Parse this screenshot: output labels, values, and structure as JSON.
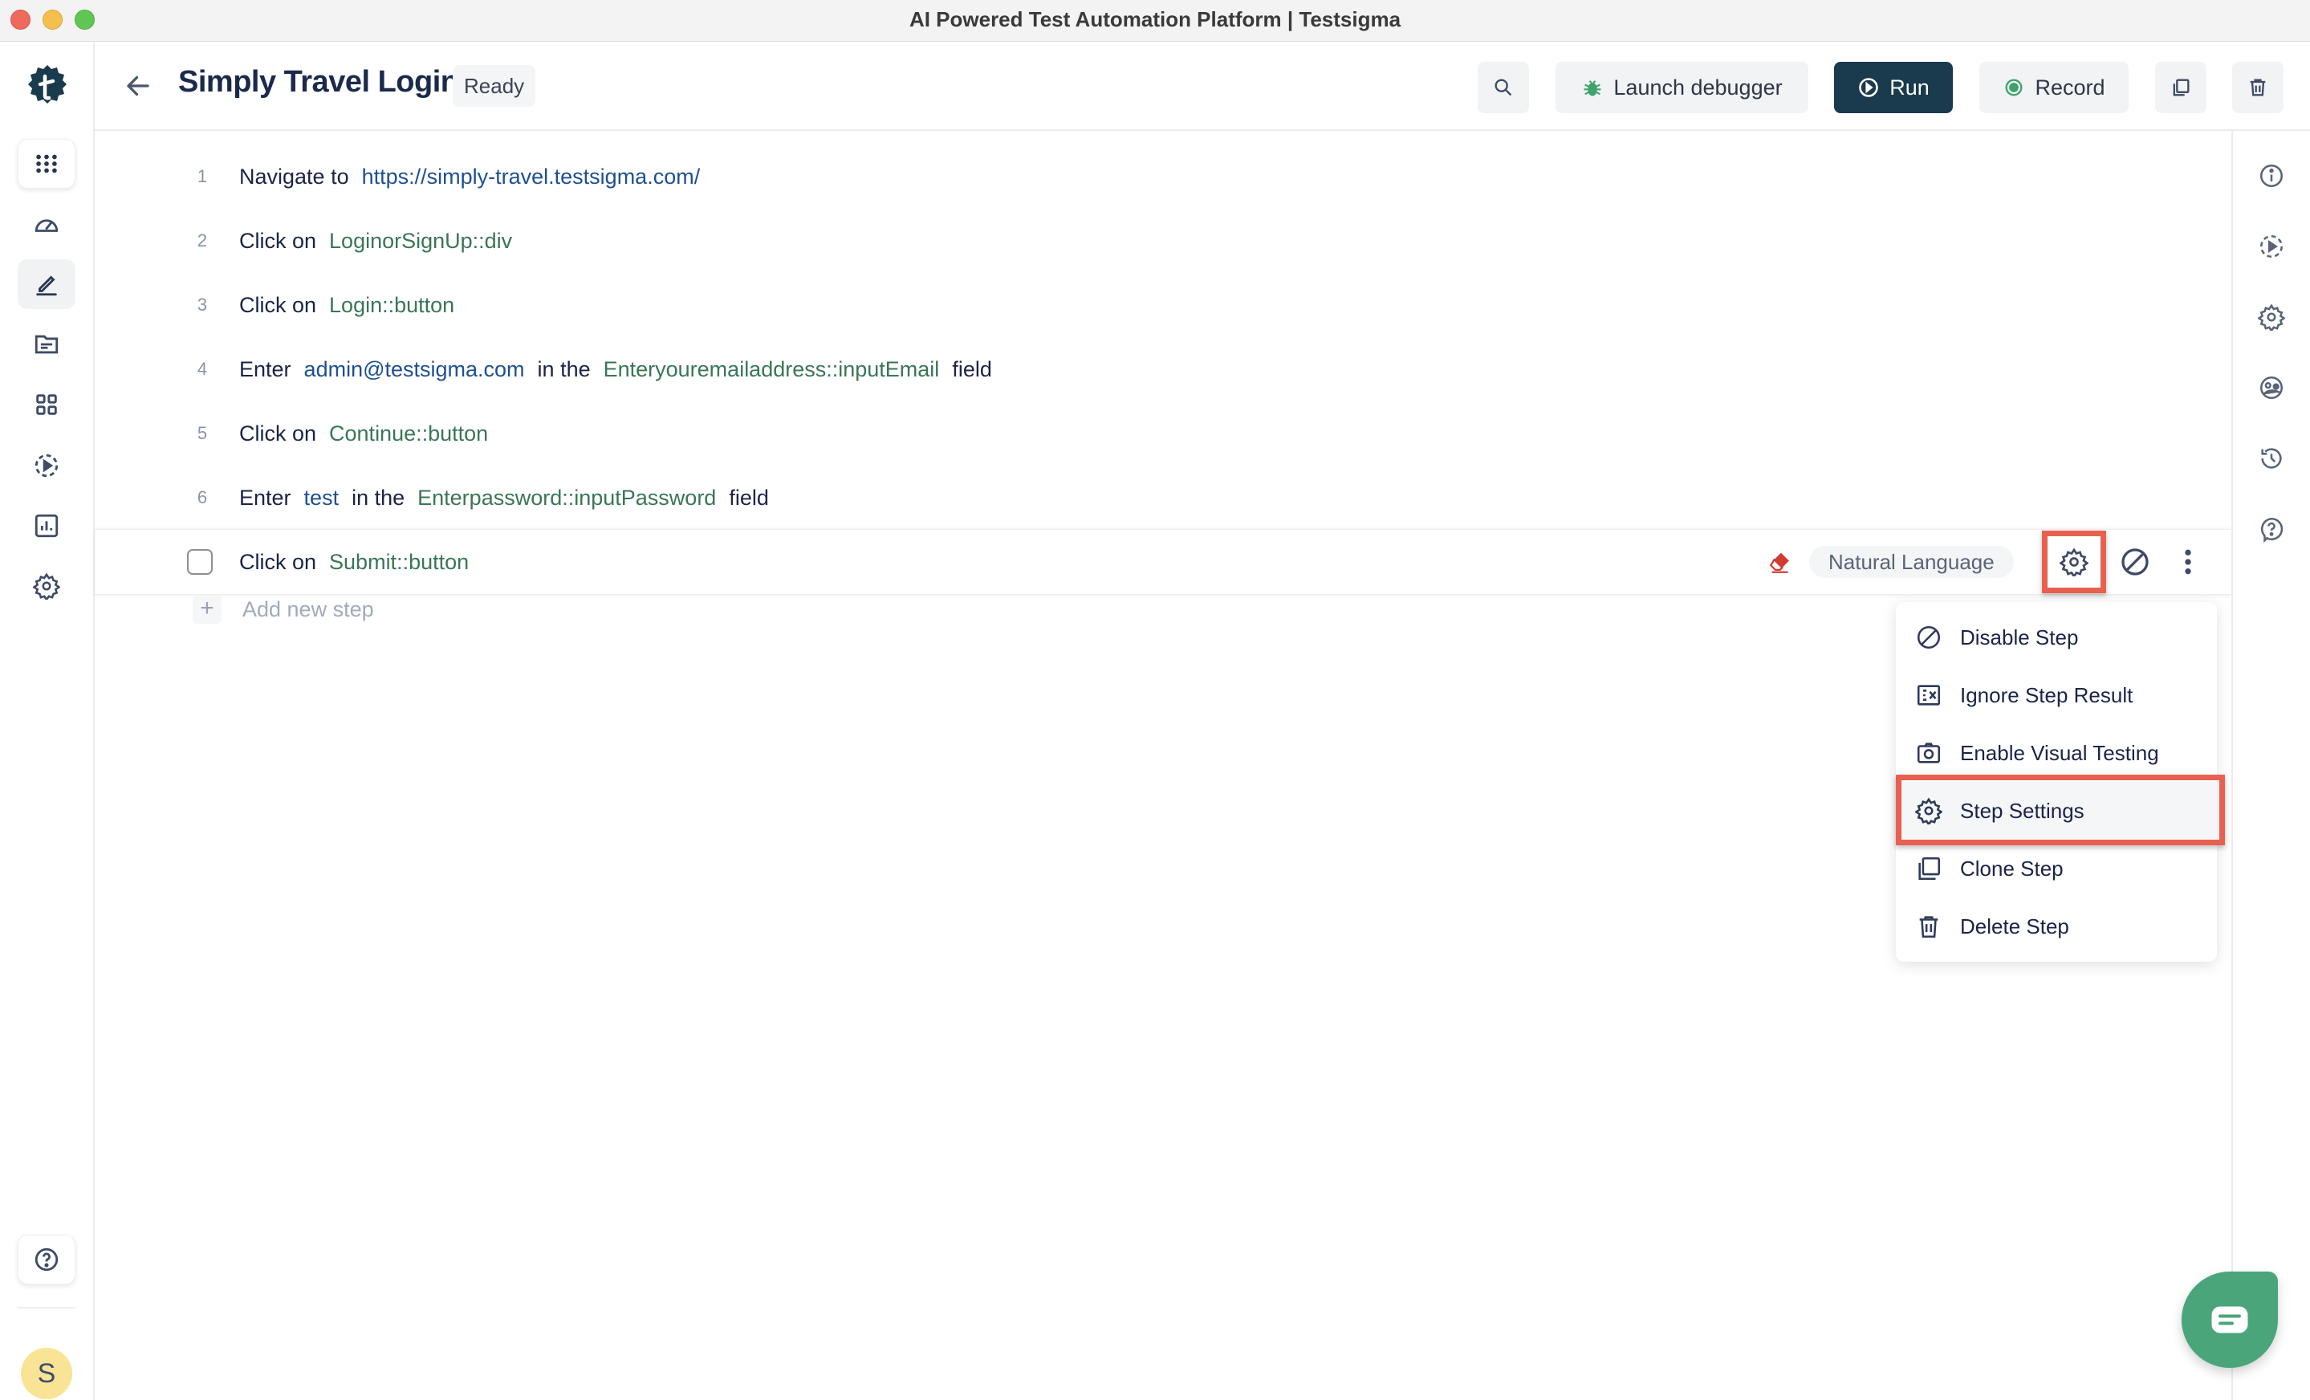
{
  "window": {
    "title": "AI Powered Test Automation Platform | Testsigma"
  },
  "sidebar": {
    "logo": "testsigma-logo",
    "items": [
      {
        "name": "apps-grid",
        "icon": "grid-dots-icon"
      },
      {
        "name": "dashboard",
        "icon": "speedometer-icon"
      },
      {
        "name": "test-cases",
        "icon": "pencil-icon",
        "active": true
      },
      {
        "name": "test-data",
        "icon": "folder-icon"
      },
      {
        "name": "elements",
        "icon": "four-squares-icon"
      },
      {
        "name": "runs",
        "icon": "dashed-play-icon"
      },
      {
        "name": "reports",
        "icon": "bar-chart-icon"
      },
      {
        "name": "settings",
        "icon": "gear-icon"
      }
    ],
    "help_icon": "help-circle-icon",
    "avatar_initial": "S"
  },
  "header": {
    "title": "Simply Travel Login",
    "status": "Ready",
    "buttons": {
      "search": "search-icon",
      "launch_debugger": "Launch debugger",
      "run": "Run",
      "record": "Record",
      "copy": "copy-icon",
      "delete": "trash-icon"
    }
  },
  "steps": [
    {
      "number": "1",
      "tokens": [
        {
          "type": "plain",
          "text": "Navigate to"
        },
        {
          "type": "data",
          "text": "https://simply-travel.testsigma.com/"
        }
      ]
    },
    {
      "number": "2",
      "tokens": [
        {
          "type": "plain",
          "text": "Click on"
        },
        {
          "type": "elem",
          "text": "LoginorSignUp::div"
        }
      ]
    },
    {
      "number": "3",
      "tokens": [
        {
          "type": "plain",
          "text": "Click on"
        },
        {
          "type": "elem",
          "text": "Login::button"
        }
      ]
    },
    {
      "number": "4",
      "tokens": [
        {
          "type": "plain",
          "text": "Enter"
        },
        {
          "type": "data",
          "text": "admin@testsigma.com"
        },
        {
          "type": "plain",
          "text": "in the"
        },
        {
          "type": "elem",
          "text": "Enteryouremailaddress::inputEmail"
        },
        {
          "type": "plain",
          "text": "field"
        }
      ]
    },
    {
      "number": "5",
      "tokens": [
        {
          "type": "plain",
          "text": "Click on"
        },
        {
          "type": "elem",
          "text": "Continue::button"
        }
      ]
    },
    {
      "number": "6",
      "tokens": [
        {
          "type": "plain",
          "text": "Enter"
        },
        {
          "type": "data",
          "text": "test"
        },
        {
          "type": "plain",
          "text": "in the"
        },
        {
          "type": "elem",
          "text": "Enterpassword::inputPassword"
        },
        {
          "type": "plain",
          "text": "field"
        }
      ]
    }
  ],
  "selected_step": {
    "checked": false,
    "tokens": [
      {
        "type": "plain",
        "text": "Click on"
      },
      {
        "type": "elem",
        "text": "Submit::button"
      }
    ],
    "mode_label": "Natural Language"
  },
  "add_step": {
    "label": "Add new step"
  },
  "step_menu": {
    "items": [
      {
        "label": "Disable Step",
        "icon": "disable-icon"
      },
      {
        "label": "Ignore Step Result",
        "icon": "ignore-result-icon"
      },
      {
        "label": "Enable Visual Testing",
        "icon": "camera-icon"
      },
      {
        "label": "Step Settings",
        "icon": "gear-icon",
        "highlighted": true
      },
      {
        "label": "Clone Step",
        "icon": "clone-icon"
      },
      {
        "label": "Delete Step",
        "icon": "trash-icon"
      }
    ]
  },
  "right_rail": {
    "items": [
      "info-icon",
      "dashed-play-icon",
      "gear-icon",
      "people-icon",
      "history-icon",
      "help-chat-icon"
    ]
  },
  "colors": {
    "brand_dark": "#1a3a4d",
    "element_green": "#3a7656",
    "data_blue": "#1f4f94",
    "highlight_red": "#e8604f",
    "chat_green": "#4aa67a",
    "avatar_yellow": "#f9e395"
  }
}
